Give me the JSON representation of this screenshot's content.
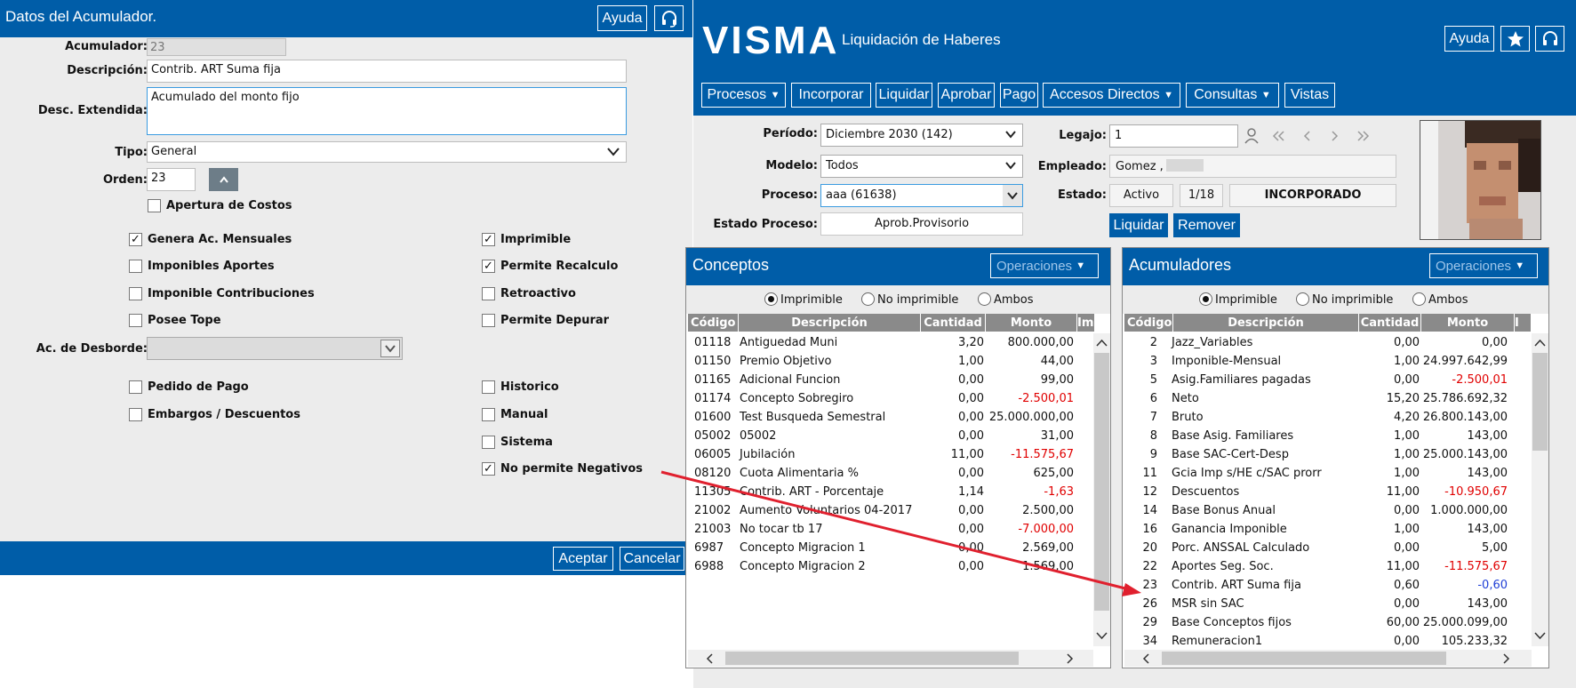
{
  "dialog": {
    "title": "Datos del Acumulador.",
    "help": "Ayuda",
    "labels": {
      "acumulador": "Acumulador:",
      "descripcion": "Descripción:",
      "desc_ext": "Desc. Extendida:",
      "tipo": "Tipo:",
      "orden": "Orden:",
      "desborde": "Ac. de Desborde:"
    },
    "values": {
      "acumulador": "23",
      "descripcion": "Contrib. ART Suma fija",
      "desc_ext": "Acumulado del monto fijo",
      "tipo": "General",
      "orden": "23",
      "desborde": ""
    },
    "checkboxes": {
      "apertura": {
        "label": "Apertura de Costos",
        "checked": false
      },
      "genera": {
        "label": "Genera Ac. Mensuales",
        "checked": true
      },
      "imponibles_aportes": {
        "label": "Imponibles Aportes",
        "checked": false
      },
      "imponible_contrib": {
        "label": "Imponible Contribuciones",
        "checked": false
      },
      "posee_tope": {
        "label": "Posee Tope",
        "checked": false
      },
      "imprimible": {
        "label": "Imprimible",
        "checked": true
      },
      "recalculo": {
        "label": "Permite Recalculo",
        "checked": true
      },
      "retroactivo": {
        "label": "Retroactivo",
        "checked": false
      },
      "depurar": {
        "label": "Permite Depurar",
        "checked": false
      },
      "pedido": {
        "label": "Pedido de Pago",
        "checked": false
      },
      "embargos": {
        "label": "Embargos / Descuentos",
        "checked": false
      },
      "historico": {
        "label": "Historico",
        "checked": false
      },
      "manual": {
        "label": "Manual",
        "checked": false
      },
      "sistema": {
        "label": "Sistema",
        "checked": false
      },
      "no_neg": {
        "label": "No permite Negativos",
        "checked": true
      }
    },
    "accept": "Aceptar",
    "cancel": "Cancelar"
  },
  "app": {
    "brand": "VISMA",
    "title": "Liquidación de Haberes",
    "help": "Ayuda",
    "nav": [
      "Procesos",
      "Incorporar",
      "Liquidar",
      "Aprobar",
      "Pago",
      "Accesos Directos",
      "Consultas",
      "Vistas"
    ],
    "form": {
      "periodo_lbl": "Período:",
      "periodo": "Diciembre 2030 (142)",
      "modelo_lbl": "Modelo:",
      "modelo": "Todos",
      "proceso_lbl": "Proceso:",
      "proceso": "aaa (61638)",
      "estado_proc_lbl": "Estado Proceso:",
      "estado_proc": "Aprob.Provisorio",
      "legajo_lbl": "Legajo:",
      "legajo": "1",
      "empleado_lbl": "Empleado:",
      "empleado": "Gomez ,",
      "estado_lbl": "Estado:",
      "estado": "Activo",
      "estado_n": "1/18",
      "estado_inc": "INCORPORADO",
      "liquidar": "Liquidar",
      "remover": "Remover"
    },
    "conceptos": {
      "title": "Conceptos",
      "ops": "Operaciones",
      "radios": [
        "Imprimible",
        "No imprimible",
        "Ambos"
      ],
      "headers": [
        "Código",
        "Descripción",
        "Cantidad",
        "Monto",
        "Im"
      ],
      "rows": [
        [
          "01118",
          "Antiguedad Muni",
          "3,20",
          "800.000,00"
        ],
        [
          "01150",
          "Premio Objetivo",
          "1,00",
          "44,00"
        ],
        [
          "01165",
          "Adicional Funcion",
          "0,00",
          "99,00"
        ],
        [
          "01174",
          "Concepto Sobregiro",
          "0,00",
          "-2.500,01"
        ],
        [
          "01600",
          "Test Busqueda Semestral",
          "0,00",
          "25.000.000,00"
        ],
        [
          "05002",
          "05002",
          "0,00",
          "31,00"
        ],
        [
          "06005",
          "Jubilación",
          "11,00",
          "-11.575,67"
        ],
        [
          "08120",
          "Cuota Alimentaria %",
          "0,00",
          "625,00"
        ],
        [
          "11305",
          "Contrib. ART - Porcentaje",
          "1,14",
          "-1,63"
        ],
        [
          "21002",
          "Aumento Voluntarios 04-2017",
          "0,00",
          "2.500,00"
        ],
        [
          "21003",
          "No tocar tb 17",
          "0,00",
          "-7.000,00"
        ],
        [
          "6987",
          "Concepto Migracion 1",
          "0,00",
          "2.569,00"
        ],
        [
          "6988",
          "Concepto Migracion 2",
          "0,00",
          "1.569,00"
        ]
      ]
    },
    "acumuladores": {
      "title": "Acumuladores",
      "ops": "Operaciones",
      "radios": [
        "Imprimible",
        "No imprimible",
        "Ambos"
      ],
      "headers": [
        "Código",
        "Descripción",
        "Cantidad",
        "Monto",
        "I"
      ],
      "rows": [
        [
          "2",
          "Jazz_Variables",
          "0,00",
          "0,00"
        ],
        [
          "3",
          "Imponible-Mensual",
          "1,00",
          "24.997.642,99"
        ],
        [
          "5",
          "Asig.Familiares pagadas",
          "0,00",
          "-2.500,01"
        ],
        [
          "6",
          "Neto",
          "15,20",
          "25.786.692,32"
        ],
        [
          "7",
          "Bruto",
          "4,20",
          "26.800.143,00"
        ],
        [
          "8",
          "Base Asig. Familiares",
          "1,00",
          "143,00"
        ],
        [
          "9",
          "Base SAC-Cert-Desp",
          "1,00",
          "25.000.143,00"
        ],
        [
          "11",
          "Gcia Imp s/HE c/SAC prorr",
          "1,00",
          "143,00"
        ],
        [
          "12",
          "Descuentos",
          "11,00",
          "-10.950,67"
        ],
        [
          "14",
          "Base Bonus Anual",
          "0,00",
          "1.000.000,00"
        ],
        [
          "16",
          "Ganancia Imponible",
          "1,00",
          "143,00"
        ],
        [
          "20",
          "Porc. ANSSAL Calculado",
          "0,00",
          "5,00"
        ],
        [
          "22",
          "Aportes Seg. Soc.",
          "11,00",
          "-11.575,67"
        ],
        [
          "23",
          "Contrib. ART Suma fija",
          "0,60",
          "-0,60"
        ],
        [
          "26",
          "MSR sin SAC",
          "0,00",
          "143,00"
        ],
        [
          "29",
          "Base Conceptos fijos",
          "60,00",
          "25.000.099,00"
        ],
        [
          "34",
          "Remuneracion1",
          "0,00",
          "105.233,32"
        ]
      ]
    }
  },
  "colors": {
    "brand": "#005da8",
    "negative": "#e00000",
    "highlight": "#1f3fd6",
    "arrow": "#e0202e"
  }
}
